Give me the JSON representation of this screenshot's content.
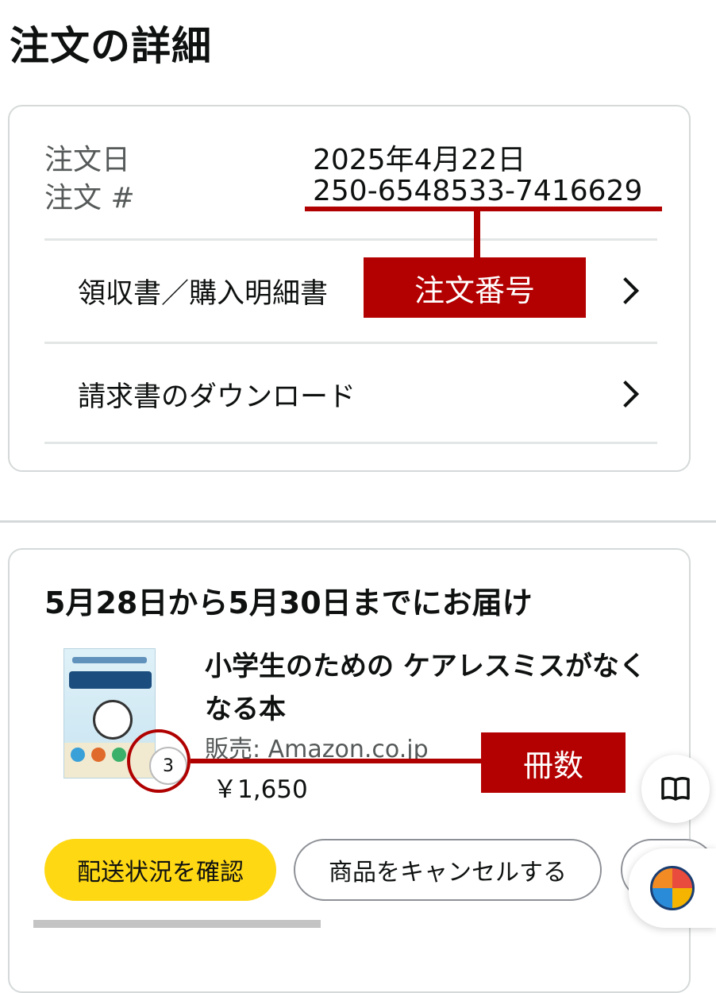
{
  "page": {
    "title": "注文の詳細"
  },
  "order_info": {
    "date_label": "注文日",
    "date_value": "2025年4月22日",
    "number_label": "注文 #",
    "number_value": "250-6548533-7416629",
    "links": [
      {
        "label": "領収書／購入明細書",
        "icon": "chevron-right-icon"
      },
      {
        "label": "請求書のダウンロード",
        "icon": "chevron-right-icon"
      }
    ]
  },
  "shipment": {
    "delivery_title": "5月28日から5月30日までにお届け",
    "product": {
      "title": "小学生のための ケアレスミスがなくなる本",
      "seller": "販売: Amazon.co.jp",
      "price": "￥1,650",
      "quantity": "3"
    },
    "buttons": {
      "track": "配送状況を確認",
      "cancel": "商品をキャンセルする"
    }
  },
  "annotations": {
    "order_number": "注文番号",
    "quantity": "冊数",
    "color": "#b30000"
  },
  "colors": {
    "primary_button": "#ffd814",
    "text": "#0f1111",
    "muted": "#565959"
  },
  "floating": {
    "reader_icon": "open-book-icon",
    "app_icon": "app-logo-icon"
  }
}
